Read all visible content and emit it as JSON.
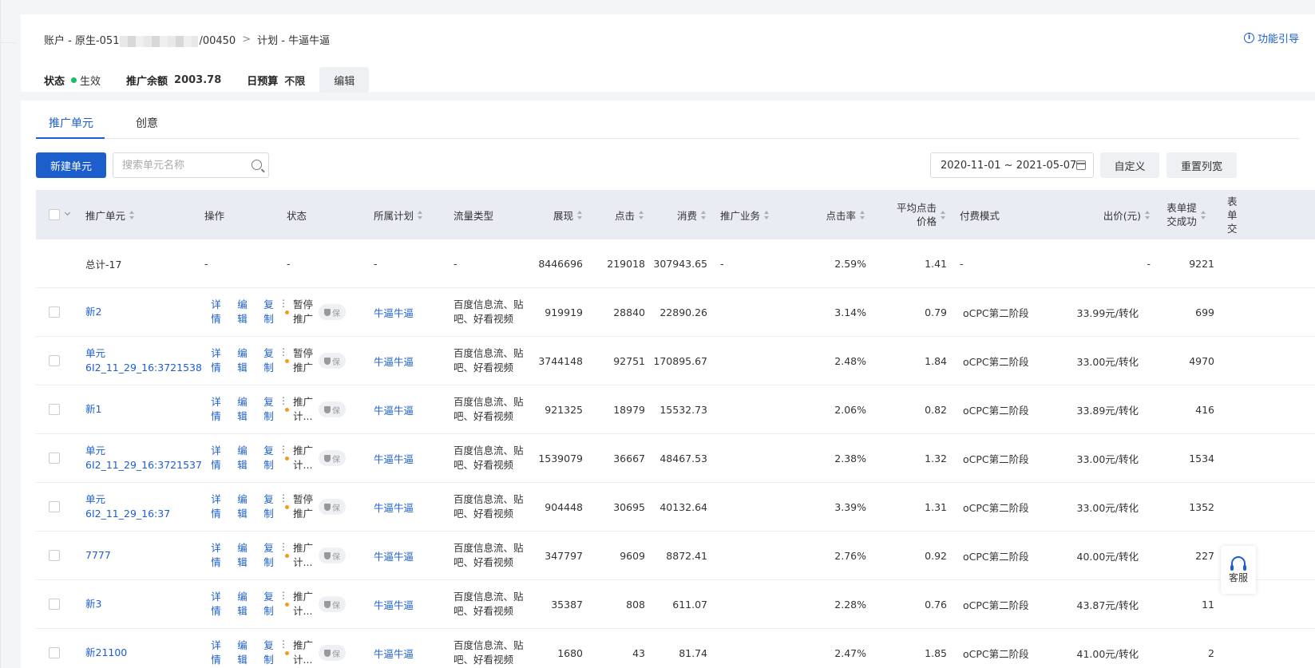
{
  "header": {
    "account_prefix": "账户 - 原生-051",
    "account_suffix": "/00450",
    "plan_crumb": "计划 - 牛逼牛逼",
    "guide_link": "功能引导",
    "status_label": "状态",
    "status_value": "生效",
    "balance_label": "推广余额",
    "balance_value": "2003.78",
    "budget_label": "日预算",
    "budget_value": "不限",
    "edit_button": "编辑"
  },
  "tabs": [
    {
      "label": "推广单元",
      "active": true
    },
    {
      "label": "创意",
      "active": false
    }
  ],
  "toolbar": {
    "new_unit_button": "新建单元",
    "search_placeholder": "搜索单元名称",
    "date_range": "2020-11-01 ~ 2021-05-07",
    "custom_button": "自定义",
    "reset_width_button": "重置列宽"
  },
  "columns": [
    "推广单元",
    "操作",
    "状态",
    "所属计划",
    "流量类型",
    "展现",
    "点击",
    "消费",
    "推广业务",
    "点击率",
    "平均点击价格",
    "付费模式",
    "出价(元)",
    "表单提交成功",
    "表单交"
  ],
  "total_row": {
    "name": "总计-17",
    "ops": "-",
    "status": "-",
    "plan": "-",
    "traffic": "-",
    "impressions": "8446696",
    "clicks": "219018",
    "cost": "307943.65",
    "business": "-",
    "ctr": "2.59%",
    "avg_cpc": "1.41",
    "pay_mode": "-",
    "bid": "-",
    "form_success": "9221"
  },
  "ops_labels": [
    "详情",
    "编辑",
    "复制"
  ],
  "shield_label": "保",
  "rows": [
    {
      "name": "新2",
      "status": "暂停推广",
      "plan": "牛逼牛逼",
      "traffic": "百度信息流、贴吧、好看视频",
      "impressions": "919919",
      "clicks": "28840",
      "cost": "22890.26",
      "ctr": "3.14%",
      "avg_cpc": "0.79",
      "pay_mode": "oCPC第二阶段",
      "bid": "33.99元/转化",
      "form_success": "699"
    },
    {
      "name": "单元6I2_11_29_16:3721538",
      "status": "暂停推广",
      "plan": "牛逼牛逼",
      "traffic": "百度信息流、贴吧、好看视频",
      "impressions": "3744148",
      "clicks": "92751",
      "cost": "170895.67",
      "ctr": "2.48%",
      "avg_cpc": "1.84",
      "pay_mode": "oCPC第二阶段",
      "bid": "33.00元/转化",
      "form_success": "4970"
    },
    {
      "name": "新1",
      "status": "推广计...",
      "plan": "牛逼牛逼",
      "traffic": "百度信息流、贴吧、好看视频",
      "impressions": "921325",
      "clicks": "18979",
      "cost": "15532.73",
      "ctr": "2.06%",
      "avg_cpc": "0.82",
      "pay_mode": "oCPC第二阶段",
      "bid": "33.89元/转化",
      "form_success": "416"
    },
    {
      "name": "单元6I2_11_29_16:3721537",
      "status": "推广计...",
      "plan": "牛逼牛逼",
      "traffic": "百度信息流、贴吧、好看视频",
      "impressions": "1539079",
      "clicks": "36667",
      "cost": "48467.53",
      "ctr": "2.38%",
      "avg_cpc": "1.32",
      "pay_mode": "oCPC第二阶段",
      "bid": "33.00元/转化",
      "form_success": "1534"
    },
    {
      "name": "单元6I2_11_29_16:37",
      "status": "暂停推广",
      "plan": "牛逼牛逼",
      "traffic": "百度信息流、贴吧、好看视频",
      "impressions": "904448",
      "clicks": "30695",
      "cost": "40132.64",
      "ctr": "3.39%",
      "avg_cpc": "1.31",
      "pay_mode": "oCPC第二阶段",
      "bid": "33.00元/转化",
      "form_success": "1352"
    },
    {
      "name": "7777",
      "status": "推广计...",
      "plan": "牛逼牛逼",
      "traffic": "百度信息流、贴吧、好看视频",
      "impressions": "347797",
      "clicks": "9609",
      "cost": "8872.41",
      "ctr": "2.76%",
      "avg_cpc": "0.92",
      "pay_mode": "oCPC第二阶段",
      "bid": "40.00元/转化",
      "form_success": "227"
    },
    {
      "name": "新3",
      "status": "推广计...",
      "plan": "牛逼牛逼",
      "traffic": "百度信息流、贴吧、好看视频",
      "impressions": "35387",
      "clicks": "808",
      "cost": "611.07",
      "ctr": "2.28%",
      "avg_cpc": "0.76",
      "pay_mode": "oCPC第二阶段",
      "bid": "43.87元/转化",
      "form_success": "11"
    },
    {
      "name": "新21100",
      "status": "推广计...",
      "plan": "牛逼牛逼",
      "traffic": "百度信息流、贴吧、好看视频",
      "impressions": "1680",
      "clicks": "43",
      "cost": "81.74",
      "ctr": "2.47%",
      "avg_cpc": "1.85",
      "pay_mode": "oCPC第二阶段",
      "bid": "41.00元/转化",
      "form_success": "2"
    }
  ],
  "float_service": {
    "label": "客服"
  },
  "colors": {
    "primary": "#1c5fcc",
    "status_active": "#1dbb64",
    "status_paused": "#f39a1f",
    "header_bg": "#e9ecf3"
  }
}
